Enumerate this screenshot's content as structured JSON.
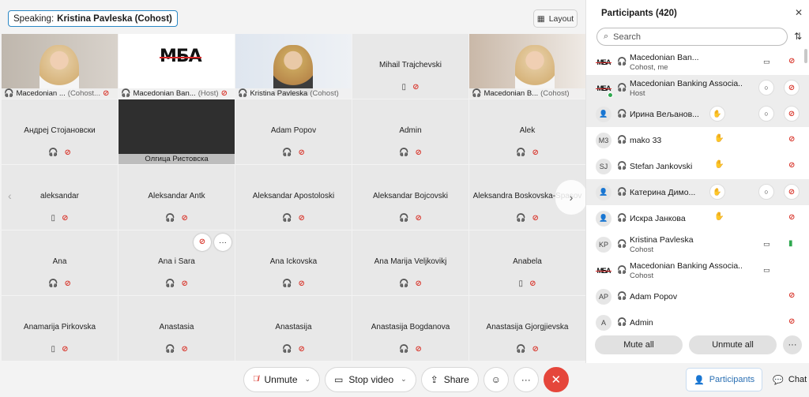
{
  "header": {
    "speaking_label": "Speaking:",
    "speaking_name": "Kristina Pavleska (Cohost)",
    "layout_label": "Layout"
  },
  "grid": {
    "tiles": [
      {
        "type": "video",
        "caption_name": "Macedonian ...",
        "caption_role": "(Cohost...",
        "muted": true
      },
      {
        "type": "logo",
        "caption_name": "Macedonian Ban...",
        "caption_role": "(Host)",
        "muted": true
      },
      {
        "type": "video",
        "caption_name": "Kristina Pavleska",
        "caption_role": "(Cohost)",
        "active": true
      },
      {
        "type": "name",
        "name": "Mihail Trajchevski",
        "icon": "phone",
        "muted": true
      },
      {
        "type": "video",
        "caption_name": "Macedonian B...",
        "caption_role": "(Cohost)"
      },
      {
        "type": "name",
        "name": "Андреј Стојановски",
        "icon": "headset",
        "muted": true
      },
      {
        "type": "dark",
        "caption_name": "Олгица Ристовска"
      },
      {
        "type": "name",
        "name": "Adam Popov",
        "icon": "headset",
        "muted": true
      },
      {
        "type": "name",
        "name": "Admin",
        "icon": "headset",
        "muted": true
      },
      {
        "type": "name",
        "name": "Alek",
        "icon": "headset",
        "muted": true
      },
      {
        "type": "name",
        "name": "aleksandar",
        "icon": "phone",
        "muted": true
      },
      {
        "type": "name",
        "name": "Aleksandar Antk",
        "icon": "headset",
        "muted": true
      },
      {
        "type": "name",
        "name": "Aleksandar Apostoloski",
        "icon": "headset",
        "muted": true
      },
      {
        "type": "name",
        "name": "Aleksandar Bojcovski",
        "icon": "headset",
        "muted": true
      },
      {
        "type": "name",
        "name": "Aleksandra Boskovska-Spasov",
        "icon": "headset",
        "muted": true
      },
      {
        "type": "name",
        "name": "Ana",
        "icon": "headset",
        "muted": true
      },
      {
        "type": "name",
        "name": "Ana i Sara",
        "icon": "headset",
        "muted": true,
        "hover": true
      },
      {
        "type": "name",
        "name": "Ana Ickovska",
        "icon": "headset",
        "muted": true
      },
      {
        "type": "name",
        "name": "Ana Marija Veljkovikj",
        "icon": "headset",
        "muted": true
      },
      {
        "type": "name",
        "name": "Anabela",
        "icon": "phone",
        "muted": true
      },
      {
        "type": "name",
        "name": "Anamarija Pirkovska",
        "icon": "phone",
        "muted": true
      },
      {
        "type": "name",
        "name": "Anastasia",
        "icon": "headset",
        "muted": true
      },
      {
        "type": "name",
        "name": "Anastasija",
        "icon": "headset",
        "muted": true
      },
      {
        "type": "name",
        "name": "Anastasija Bogdanova",
        "icon": "headset",
        "muted": true
      },
      {
        "type": "name",
        "name": "Anastasija Gjorgjievska",
        "icon": "headset",
        "muted": true
      }
    ]
  },
  "toolbar": {
    "unmute_label": "Unmute",
    "stop_video_label": "Stop video",
    "share_label": "Share"
  },
  "panel": {
    "title": "Participants (420)",
    "search_placeholder": "Search",
    "participants": [
      {
        "avatar": "МБА",
        "logo": true,
        "name": "Macedonian Ban...",
        "role": "Cohost, me",
        "video": true,
        "mute": "muted"
      },
      {
        "avatar": "МБА",
        "logo": true,
        "dot": true,
        "name": "Macedonian Banking Associa...",
        "role": "Host",
        "bubble": true,
        "mute": "muted-circle",
        "hl": true
      },
      {
        "avatar": "person",
        "name": "Ирина Вељанов...",
        "handc": true,
        "bubble": true,
        "mute": "muted-circle",
        "hl": true
      },
      {
        "avatar": "M3",
        "name": "mako 33",
        "hand": true,
        "mute": "muted"
      },
      {
        "avatar": "SJ",
        "name": "Stefan Jankovski",
        "hand": true,
        "mute": "muted"
      },
      {
        "avatar": "person",
        "name": "Катерина Димо...",
        "handc": true,
        "bubble": true,
        "mute": "muted-circle",
        "hl": true
      },
      {
        "avatar": "person",
        "name": "Искра Јанкова",
        "hand": true,
        "mute": "muted"
      },
      {
        "avatar": "KP",
        "name": "Kristina Pavleska",
        "role": "Cohost",
        "video": true,
        "mute": "on"
      },
      {
        "avatar": "МБА",
        "logo": true,
        "name": "Macedonian Banking Associa...",
        "role": "Cohost",
        "video": true,
        "mute": "none"
      },
      {
        "avatar": "AP",
        "name": "Adam Popov",
        "mute": "muted"
      },
      {
        "avatar": "A",
        "name": "Admin",
        "mute": "muted"
      }
    ],
    "mute_all_label": "Mute all",
    "unmute_all_label": "Unmute all"
  },
  "side_tabs": {
    "participants_label": "Participants",
    "chat_label": "Chat"
  },
  "colors": {
    "accent": "#2a87c4",
    "mute_red": "#d9382e",
    "end_red": "#e5463b",
    "active_green": "#2fa84f"
  }
}
